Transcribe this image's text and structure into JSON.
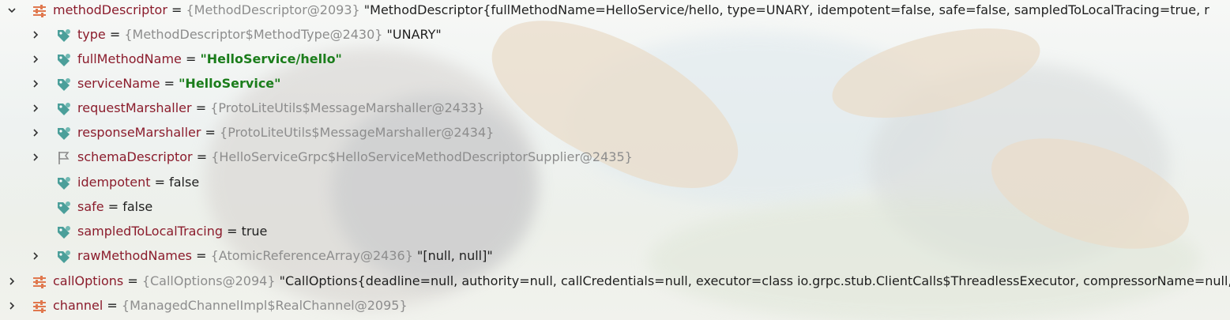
{
  "colors": {
    "field_name": "#8b1c2c",
    "object_ref": "#8d8d8d",
    "string_value": "#1b7d1b",
    "icon_teal": "#4b9f9a",
    "icon_orange": "#e0784e"
  },
  "rows": [
    {
      "name": "methodDescriptor",
      "eq": " = ",
      "ref": "{MethodDescriptor@2093}",
      "value": " \"MethodDescriptor{fullMethodName=HelloService/hello, type=UNARY, idempotent=false, safe=false, sampledToLocalTracing=true, r",
      "icon": "settings-sliders-icon",
      "toggle": "chevron-down-icon"
    },
    {
      "name": "type",
      "eq": " = ",
      "ref": "{MethodDescriptor$MethodType@2430}",
      "value": " \"UNARY\"",
      "icon": "field-tag-icon",
      "toggle": "chevron-right-icon"
    },
    {
      "name": "fullMethodName",
      "eq": " = ",
      "ref": "",
      "value": "\"HelloService/hello\"",
      "icon": "field-tag-icon",
      "toggle": "chevron-right-icon"
    },
    {
      "name": "serviceName",
      "eq": " = ",
      "ref": "",
      "value": "\"HelloService\"",
      "icon": "field-tag-icon",
      "toggle": "chevron-right-icon"
    },
    {
      "name": "requestMarshaller",
      "eq": " = ",
      "ref": "{ProtoLiteUtils$MessageMarshaller@2433}",
      "value": "",
      "icon": "field-tag-icon",
      "toggle": "chevron-right-icon"
    },
    {
      "name": "responseMarshaller",
      "eq": " = ",
      "ref": "{ProtoLiteUtils$MessageMarshaller@2434}",
      "value": "",
      "icon": "field-tag-icon",
      "toggle": "chevron-right-icon"
    },
    {
      "name": "schemaDescriptor",
      "eq": " = ",
      "ref": "{HelloServiceGrpc$HelloServiceMethodDescriptorSupplier@2435}",
      "value": "",
      "icon": "flag-icon",
      "toggle": "chevron-right-icon"
    },
    {
      "name": "idempotent",
      "eq": " = ",
      "ref": "",
      "value": "false",
      "icon": "field-tag-icon",
      "toggle": ""
    },
    {
      "name": "safe",
      "eq": " = ",
      "ref": "",
      "value": "false",
      "icon": "field-tag-icon",
      "toggle": ""
    },
    {
      "name": "sampledToLocalTracing",
      "eq": " = ",
      "ref": "",
      "value": "true",
      "icon": "field-tag-icon",
      "toggle": ""
    },
    {
      "name": "rawMethodNames",
      "eq": " = ",
      "ref": "{AtomicReferenceArray@2436}",
      "value": " \"[null, null]\"",
      "icon": "field-tag-icon",
      "toggle": "chevron-right-icon"
    },
    {
      "name": "callOptions",
      "eq": " = ",
      "ref": "{CallOptions@2094}",
      "value": " \"CallOptions{deadline=null, authority=null, callCredentials=null, executor=class io.grpc.stub.ClientCalls$ThreadlessExecutor, compressorName=null,",
      "icon": "settings-sliders-icon",
      "toggle": "chevron-right-icon"
    },
    {
      "name": "channel",
      "eq": " = ",
      "ref": "{ManagedChannelImpl$RealChannel@2095}",
      "value": "",
      "icon": "settings-sliders-icon",
      "toggle": "chevron-right-icon"
    }
  ]
}
